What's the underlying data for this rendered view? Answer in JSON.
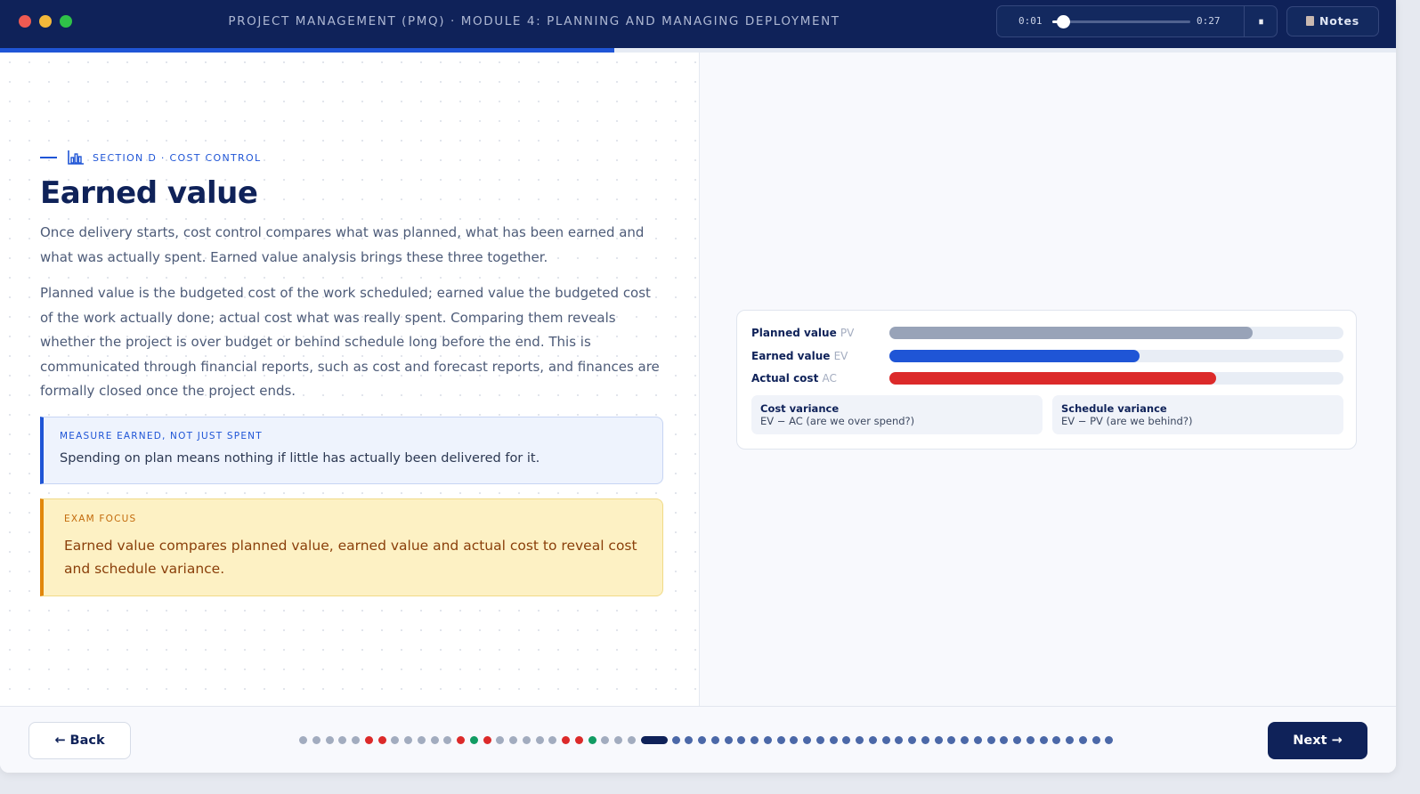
{
  "app": {
    "title": "Project Management (PMQ) · Module 4: Planning and Managing Deployment",
    "progress_percent": 44
  },
  "player": {
    "current_time": "0:01",
    "total_time": "0:27",
    "position_fraction": 0.04,
    "pause_glyph": "⏸",
    "notes_label": "Notes",
    "notes_icon": "notes-page-icon"
  },
  "section": {
    "eyebrow": "Section D · Cost control",
    "icon": "bar-chart-icon",
    "title": "Earned value",
    "paragraphs": [
      "Once delivery starts, cost control compares what was planned, what has been earned and what was actually spent. Earned value analysis brings these three together.",
      "Planned value is the budgeted cost of the work scheduled; earned value the budgeted cost of the work actually done; actual cost what was really spent. Comparing them reveals whether the project is over budget or behind schedule long before the end. This is communicated through financial reports, such as cost and forecast reports, and finances are formally closed once the project ends."
    ]
  },
  "callouts": {
    "tip": {
      "label": "Measure earned, not just spent",
      "text": "Spending on plan means nothing if little has actually been delivered for it."
    },
    "exam": {
      "label": "Exam focus",
      "text": "Earned value compares planned value, earned value and actual cost to reveal cost and schedule variance."
    }
  },
  "chart_data": {
    "type": "bar",
    "orientation": "horizontal",
    "categories": [
      "Planned value",
      "Earned value",
      "Actual cost"
    ],
    "abbreviations": [
      "PV",
      "EV",
      "AC"
    ],
    "values": [
      0.8,
      0.55,
      0.72
    ],
    "xlim": [
      0,
      1
    ],
    "colors": [
      "#98a3b8",
      "#1f55d6",
      "#dc2a2a"
    ],
    "variances": [
      {
        "title": "Cost variance",
        "formula": "EV − AC (are we over spend?)"
      },
      {
        "title": "Schedule variance",
        "formula": "EV − PV (are we behind?)"
      }
    ]
  },
  "nav": {
    "back_label": "← Back",
    "next_label": "Next →",
    "current_index": 26,
    "dots": [
      "done",
      "done",
      "done",
      "done",
      "done",
      "wrong",
      "wrong",
      "done",
      "done",
      "done",
      "done",
      "done",
      "wrong",
      "right",
      "wrong",
      "done",
      "done",
      "done",
      "done",
      "done",
      "wrong",
      "wrong",
      "right",
      "done",
      "done",
      "done",
      "current",
      "todo",
      "todo",
      "todo",
      "todo",
      "todo",
      "todo",
      "todo",
      "todo",
      "todo",
      "todo",
      "todo",
      "todo",
      "todo",
      "todo",
      "todo",
      "todo",
      "todo",
      "todo",
      "todo",
      "todo",
      "todo",
      "todo",
      "todo",
      "todo",
      "todo",
      "todo",
      "todo",
      "todo",
      "todo",
      "todo",
      "todo",
      "todo",
      "todo",
      "todo"
    ],
    "dot_colors": {
      "done": "#a2acbf",
      "wrong": "#dc2a2a",
      "right": "#119c63",
      "current": "#0f2259",
      "todo": "#4b68a8"
    }
  }
}
